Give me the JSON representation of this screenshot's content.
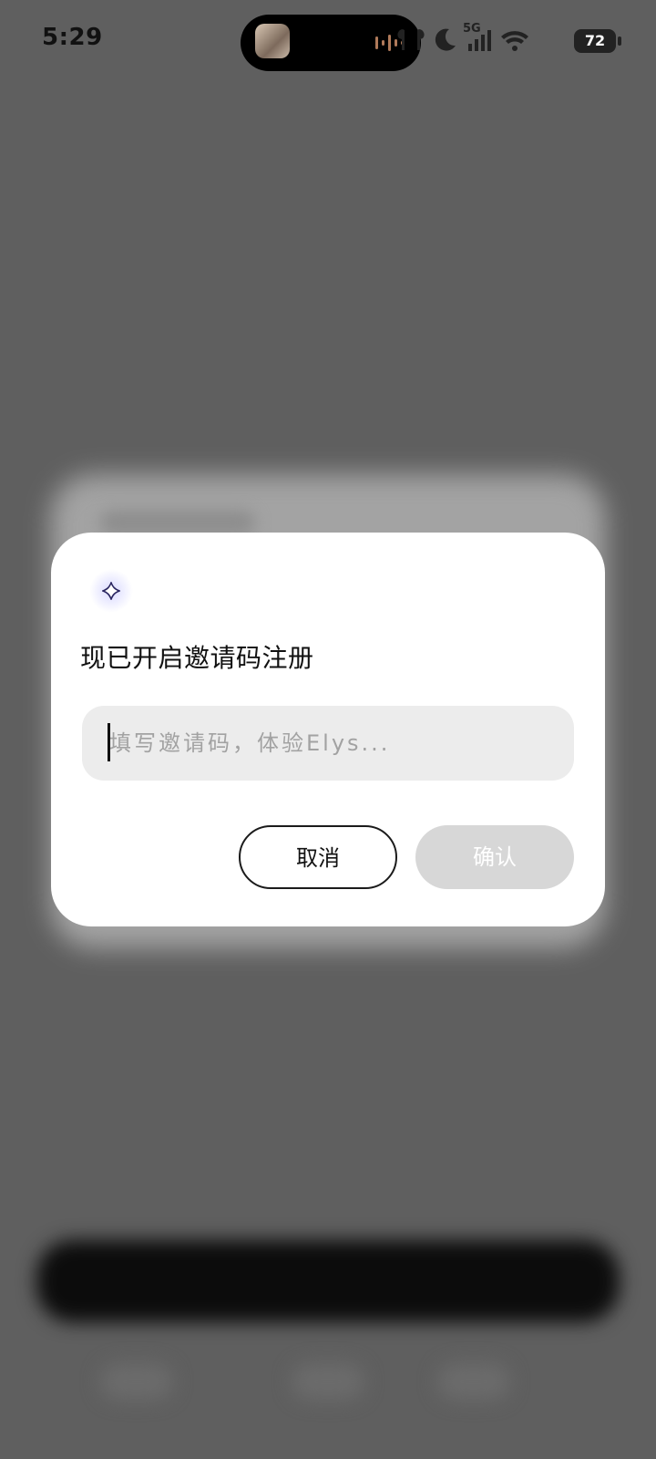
{
  "status_bar": {
    "time": "5:29",
    "battery": "72",
    "network": "5G"
  },
  "dialog": {
    "title": "现已开启邀请码注册",
    "input": {
      "placeholder": "填写邀请码，体验Elys...",
      "value": ""
    },
    "cancel_label": "取消",
    "confirm_label": "确认"
  },
  "colors": {
    "dialog_bg": "#ffffff",
    "input_bg": "#ececec",
    "confirm_disabled_bg": "#d7d7d7",
    "overlay": "#5f5f5f"
  }
}
